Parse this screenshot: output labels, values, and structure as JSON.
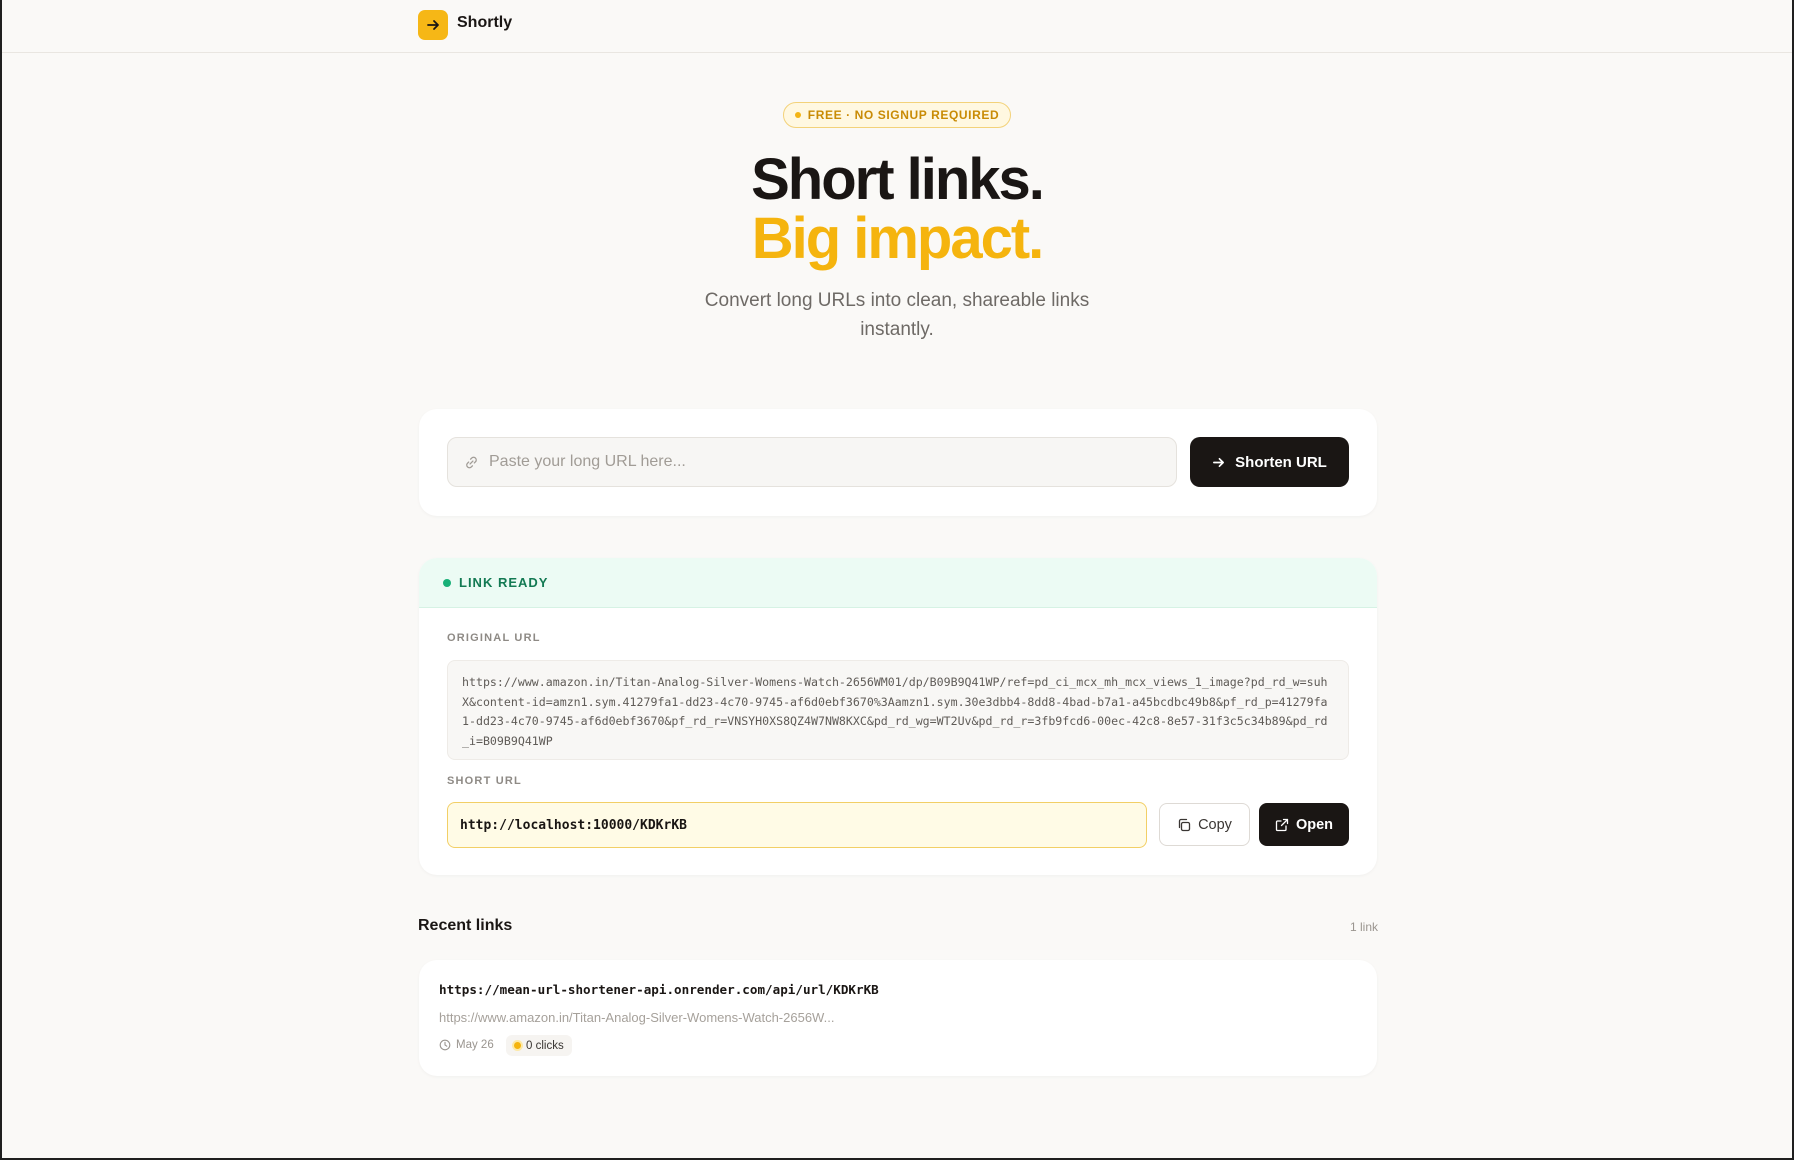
{
  "app": {
    "brand": "Shortly"
  },
  "hero": {
    "badge": "FREE · NO SIGNUP REQUIRED",
    "title_line1": "Short links.",
    "title_line2": "Big impact.",
    "subtitle": "Convert long URLs into clean, shareable links instantly."
  },
  "shorten": {
    "placeholder": "Paste your long URL here...",
    "value": "",
    "button_label": "Shorten URL"
  },
  "result": {
    "status": "LINK READY",
    "original_label": "ORIGINAL URL",
    "original_url": "https://www.amazon.in/Titan-Analog-Silver-Womens-Watch-2656WM01/dp/B09B9Q41WP/ref=pd_ci_mcx_mh_mcx_views_1_image?pd_rd_w=suhX&content-id=amzn1.sym.41279fa1-dd23-4c70-9745-af6d0ebf3670%3Aamzn1.sym.30e3dbb4-8dd8-4bad-b7a1-a45bcdbc49b8&pf_rd_p=41279fa1-dd23-4c70-9745-af6d0ebf3670&pf_rd_r=VNSYH0XS8QZ4W7NW8KXC&pd_rd_wg=WT2Uv&pd_rd_r=3fb9fcd6-00ec-42c8-8e57-31f3c5c34b89&pd_rd_i=B09B9Q41WP",
    "short_label": "SHORT URL",
    "short_url": "http://localhost:10000/KDKrKB",
    "copy_label": "Copy",
    "open_label": "Open"
  },
  "recent": {
    "title": "Recent links",
    "count": "1 link",
    "items": [
      {
        "short_url": "https://mean-url-shortener-api.onrender.com/api/url/KDKrKB",
        "original_url": "https://www.amazon.in/Titan-Analog-Silver-Womens-Watch-2656W...",
        "date": "May 26",
        "clicks": "0 clicks"
      }
    ]
  },
  "icons": {
    "logo": "arrow-right-icon",
    "input": "link-icon",
    "shorten": "arrow-right-icon",
    "copy": "copy-icon",
    "open": "external-link-icon",
    "date": "clock-icon"
  },
  "colors": {
    "accent": "#f5b40e",
    "dark": "#1a1614",
    "success": "#18b077",
    "background": "#faf9f7"
  }
}
